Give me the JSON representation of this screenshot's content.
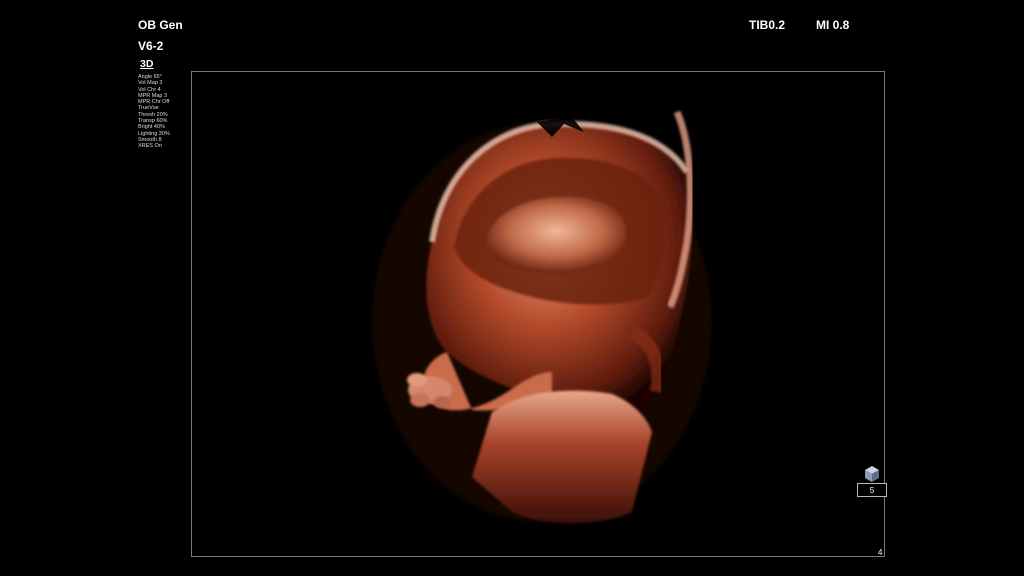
{
  "header": {
    "preset": "OB Gen",
    "probe": "V6-2",
    "mode": "3D",
    "tib": "TIB0.2",
    "mi": "MI 0.8"
  },
  "parameters": [
    "Angle 65°",
    "Vol Map 3",
    "Vol Chr 4",
    "MPR Map 3",
    "MPR Chr Off",
    "TrueVue",
    "Thresh 20%",
    "Transp 60%",
    "Bright 40%",
    "Lighting 30%",
    "Smooth 8",
    "XRES On"
  ],
  "viewport": {
    "image": "3D fetal head render",
    "rendering_tint": "#b34a2a",
    "frame_value": "5",
    "corner_number": "4",
    "orientation_icon": "cube-icon"
  }
}
